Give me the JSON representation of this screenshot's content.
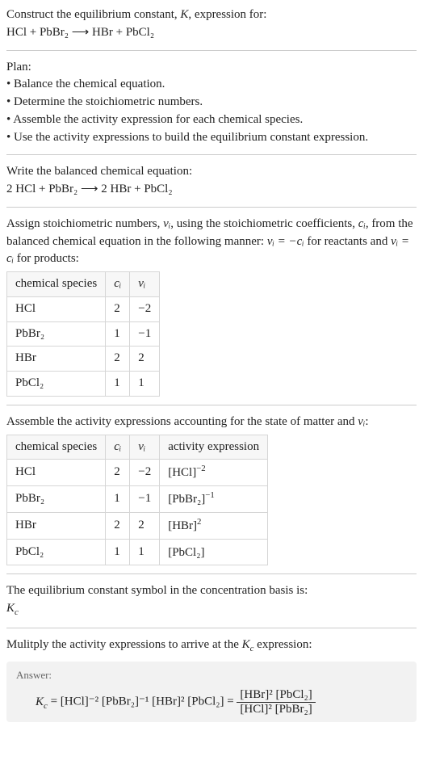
{
  "intro": {
    "line1": "Construct the equilibrium constant, ",
    "Ksym": "K",
    "line1b": ", expression for:",
    "eq_unbalanced": "HCl + PbBr₂ ⟶ HBr + PbCl₂"
  },
  "plan": {
    "title": "Plan:",
    "items": [
      "Balance the chemical equation.",
      "Determine the stoichiometric numbers.",
      "Assemble the activity expression for each chemical species.",
      "Use the activity expressions to build the equilibrium constant expression."
    ]
  },
  "balanced": {
    "title": "Write the balanced chemical equation:",
    "eq": "2 HCl + PbBr₂ ⟶ 2 HBr + PbCl₂"
  },
  "assign": {
    "text_a": "Assign stoichiometric numbers, ",
    "nu": "νᵢ",
    "text_b": ", using the stoichiometric coefficients, ",
    "ci": "cᵢ",
    "text_c": ", from the balanced chemical equation in the following manner: ",
    "rel1": "νᵢ = −cᵢ",
    "text_d": " for reactants and ",
    "rel2": "νᵢ = cᵢ",
    "text_e": " for products:"
  },
  "table1": {
    "headers": [
      "chemical species",
      "cᵢ",
      "νᵢ"
    ],
    "rows": [
      [
        "HCl",
        "2",
        "−2"
      ],
      [
        "PbBr₂",
        "1",
        "−1"
      ],
      [
        "HBr",
        "2",
        "2"
      ],
      [
        "PbCl₂",
        "1",
        "1"
      ]
    ]
  },
  "assemble": {
    "text_a": "Assemble the activity expressions accounting for the state of matter and ",
    "nu": "νᵢ",
    "text_b": ":"
  },
  "table2": {
    "headers": [
      "chemical species",
      "cᵢ",
      "νᵢ",
      "activity expression"
    ],
    "rows": [
      {
        "sp": "HCl",
        "c": "2",
        "v": "−2",
        "base": "[HCl]",
        "exp": "−2"
      },
      {
        "sp": "PbBr₂",
        "c": "1",
        "v": "−1",
        "base": "[PbBr₂]",
        "exp": "−1"
      },
      {
        "sp": "HBr",
        "c": "2",
        "v": "2",
        "base": "[HBr]",
        "exp": "2"
      },
      {
        "sp": "PbCl₂",
        "c": "1",
        "v": "1",
        "base": "[PbCl₂]",
        "exp": ""
      }
    ]
  },
  "eqconst": {
    "line": "The equilibrium constant symbol in the concentration basis is:",
    "sym": "K",
    "sub": "c"
  },
  "mult": {
    "text_a": "Mulitply the activity expressions to arrive at the ",
    "Kc": "K",
    "Kc_sub": "c",
    "text_b": " expression:"
  },
  "answer": {
    "label": "Answer:",
    "lhs_K": "K",
    "lhs_sub": "c",
    "prod": " = [HCl]⁻² [PbBr₂]⁻¹ [HBr]² [PbCl₂] = ",
    "frac_num": "[HBr]² [PbCl₂]",
    "frac_den": "[HCl]² [PbBr₂]"
  },
  "chart_data": {
    "type": "table",
    "tables": [
      {
        "title": "Stoichiometric coefficients and numbers",
        "columns": [
          "chemical species",
          "c_i",
          "nu_i"
        ],
        "rows": [
          [
            "HCl",
            2,
            -2
          ],
          [
            "PbBr2",
            1,
            -1
          ],
          [
            "HBr",
            2,
            2
          ],
          [
            "PbCl2",
            1,
            1
          ]
        ]
      },
      {
        "title": "Activity expressions",
        "columns": [
          "chemical species",
          "c_i",
          "nu_i",
          "activity expression"
        ],
        "rows": [
          [
            "HCl",
            2,
            -2,
            "[HCl]^-2"
          ],
          [
            "PbBr2",
            1,
            -1,
            "[PbBr2]^-1"
          ],
          [
            "HBr",
            2,
            2,
            "[HBr]^2"
          ],
          [
            "PbCl2",
            1,
            1,
            "[PbCl2]"
          ]
        ]
      }
    ],
    "derived": {
      "unbalanced_equation": "HCl + PbBr2 -> HBr + PbCl2",
      "balanced_equation": "2 HCl + PbBr2 -> 2 HBr + PbCl2",
      "Kc_expression": "([HBr]^2 [PbCl2]) / ([HCl]^2 [PbBr2])"
    }
  }
}
